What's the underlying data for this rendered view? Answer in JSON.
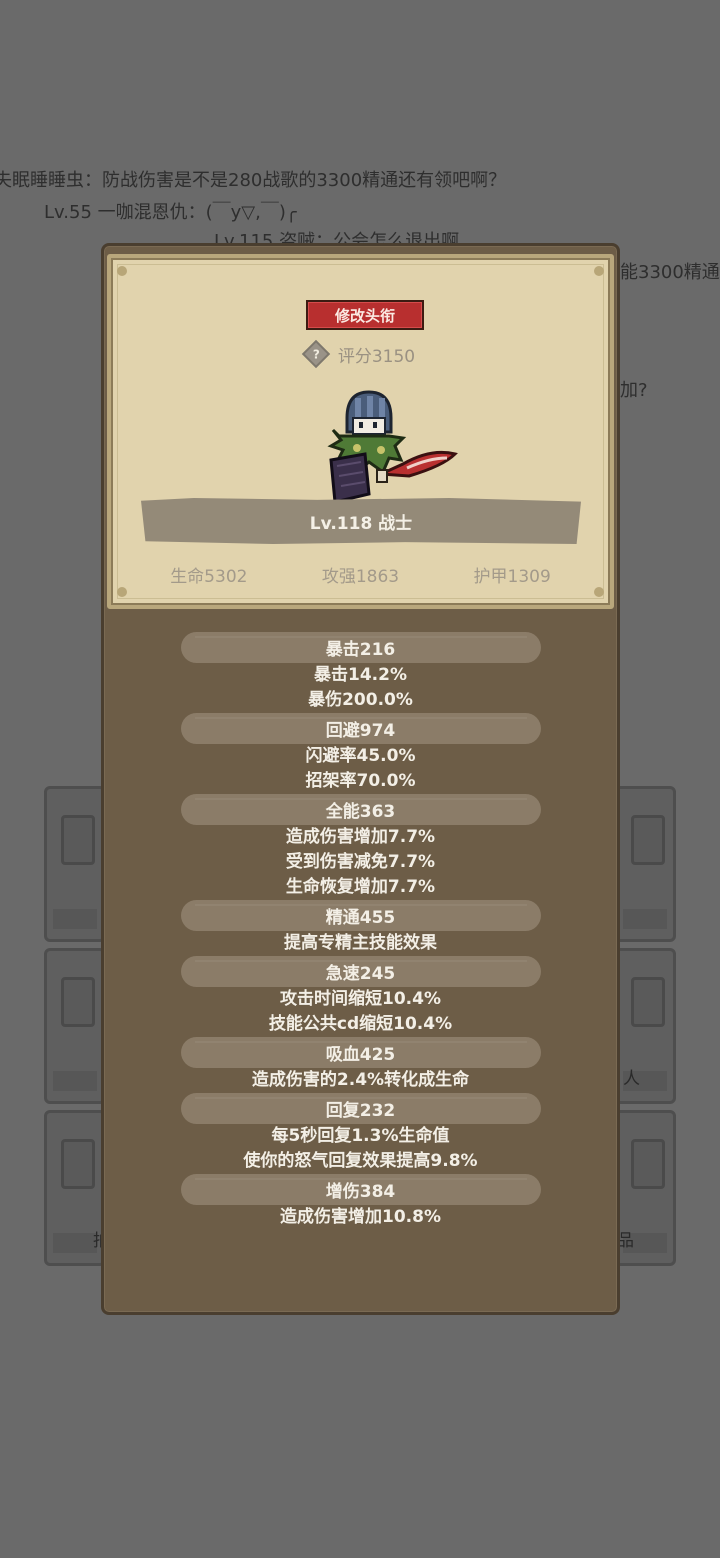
{
  "background": {
    "chat_lines": [
      "失眠睡睡虫：防战伤害是不是280战歌的3300精通还有领吧啊？",
      "Lv.55 一咖混恩仇：(￣y▽,￣)╭",
      "Lv.115 盗贼：公会怎么退出啊",
      "能3300精通,",
      "加?"
    ],
    "slot_captions": [
      "人",
      "拍",
      "品"
    ]
  },
  "profile": {
    "rename_button": "修改头衔",
    "score_label": "评分3150",
    "help_icon": "question-diamond-icon",
    "level_class": "Lv.118 战士",
    "stats": {
      "hp": "生命5302",
      "attack": "攻强1863",
      "armor": "护甲1309"
    }
  },
  "attributes": [
    {
      "header": "暴击216",
      "details": [
        "暴击14.2%",
        "暴伤200.0%"
      ]
    },
    {
      "header": "回避974",
      "details": [
        "闪避率45.0%",
        "招架率70.0%"
      ]
    },
    {
      "header": "全能363",
      "details": [
        "造成伤害增加7.7%",
        "受到伤害减免7.7%",
        "生命恢复增加7.7%"
      ]
    },
    {
      "header": "精通455",
      "details": [
        "提高专精主技能效果"
      ]
    },
    {
      "header": "急速245",
      "details": [
        "攻击时间缩短10.4%",
        "技能公共cd缩短10.4%"
      ]
    },
    {
      "header": "吸血425",
      "details": [
        "造成伤害的2.4%转化成生命"
      ]
    },
    {
      "header": "回复232",
      "details": [
        "每5秒回复1.3%生命值",
        "使你的怒气回复效果提高9.8%"
      ]
    },
    {
      "header": "增伤384",
      "details": [
        "造成伤害增加10.8%"
      ]
    }
  ],
  "colors": {
    "overlay": "#6a6a6a",
    "panel": "#6d5d47",
    "card": "#e1d3ad",
    "rename_button": "#b82f2f",
    "attr_header": "#8b7c68",
    "text_light": "#f3efe6"
  }
}
